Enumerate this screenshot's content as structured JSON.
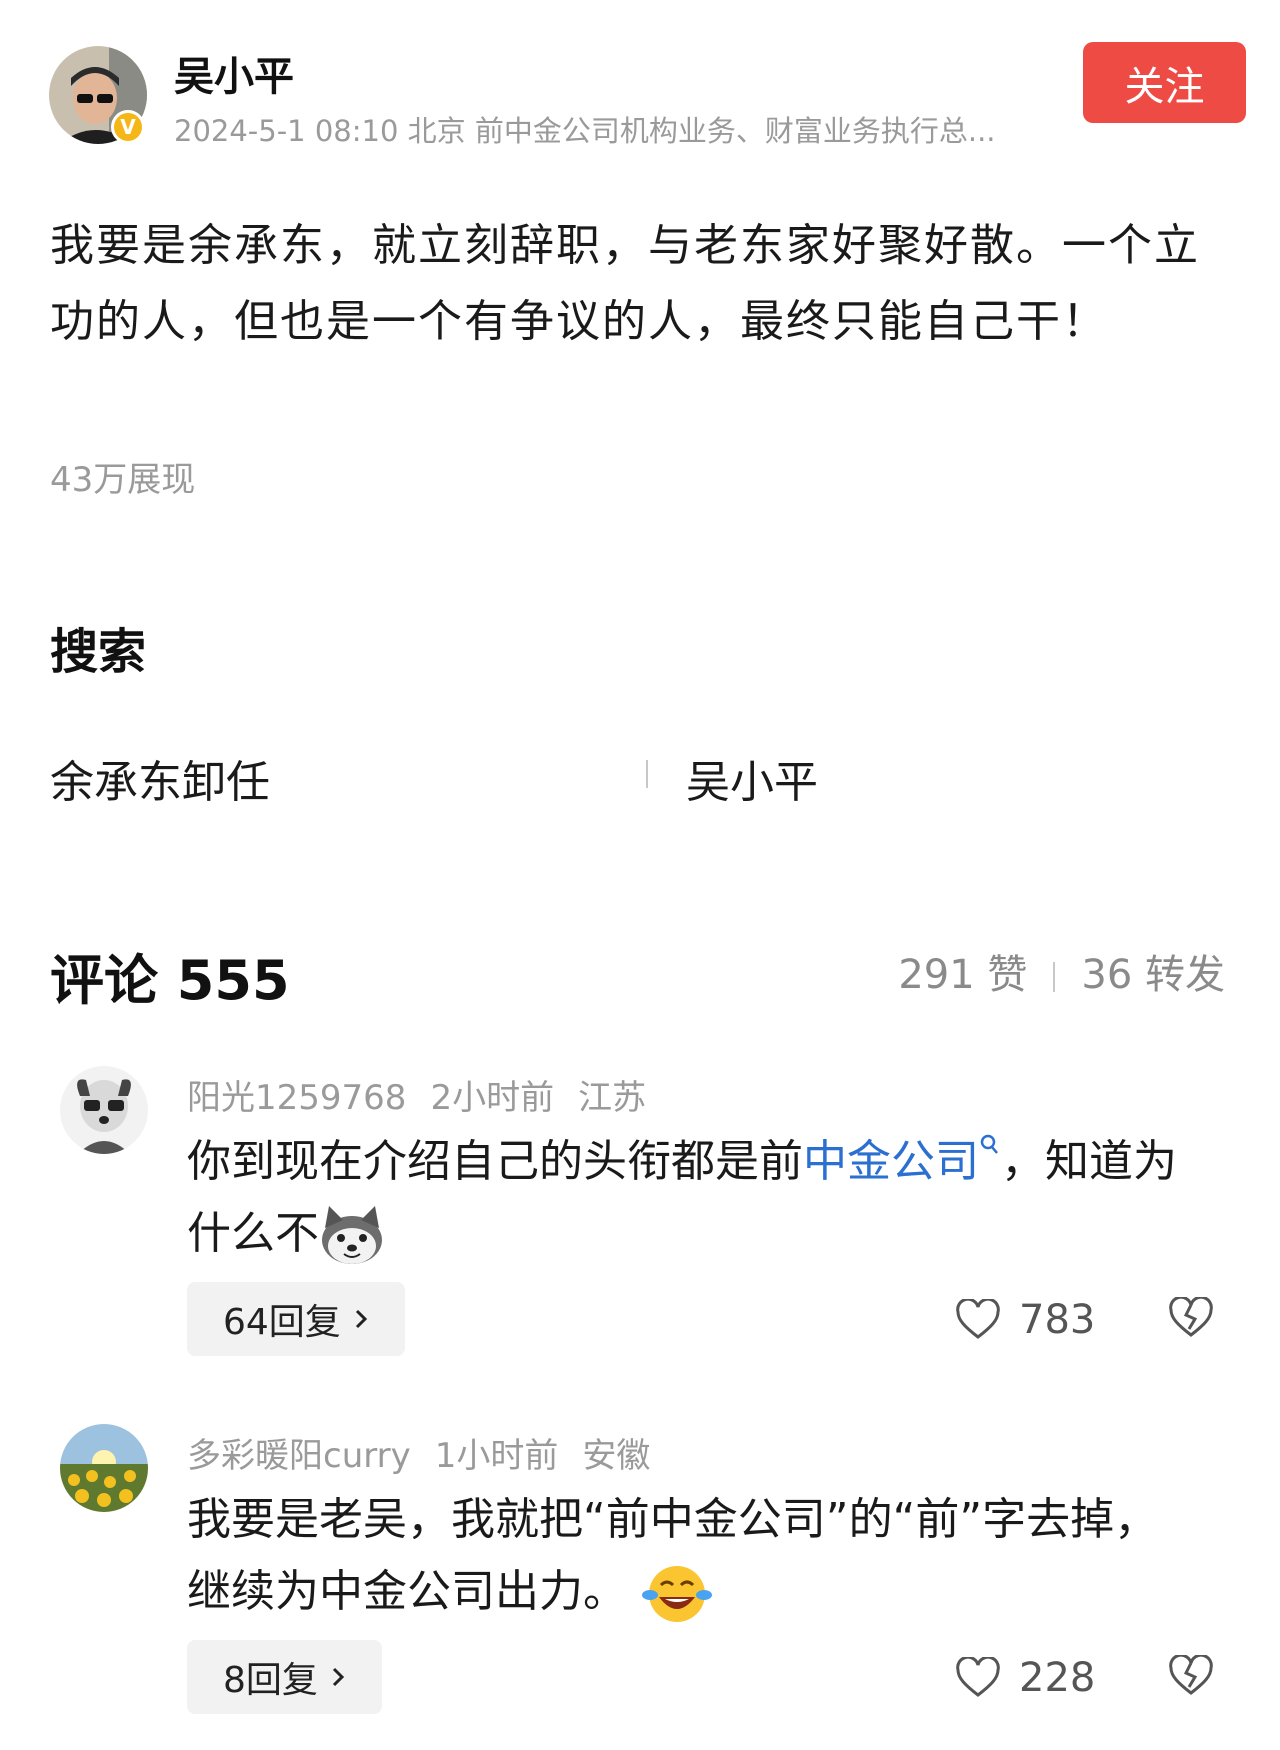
{
  "post": {
    "author": "吴小平",
    "badge": "V",
    "meta": "2024-5-1 08:10 北京 前中金公司机构业务、财富业务执行总...",
    "follow_label": "关注",
    "text": "我要是余承东，就立刻辞职，与老东家好聚好散。一个立功的人，但也是一个有争议的人，最终只能自己干！",
    "views": "43万展现"
  },
  "search": {
    "title": "搜索",
    "items": [
      "余承东卸任",
      "吴小平"
    ]
  },
  "comments_header": {
    "title": "评论 555",
    "likes": "291 赞",
    "reposts": "36 转发"
  },
  "comments": [
    {
      "user": "阳光1259768",
      "time": "2小时前",
      "location": "江苏",
      "text_before": "你到现在介绍自己的头衔都是前",
      "link": "中金公司",
      "text_after": "，知道为什么不",
      "emoji": "husky-emoji",
      "replies": "64回复",
      "likes": "783"
    },
    {
      "user": "多彩暖阳curry",
      "time": "1小时前",
      "location": "安徽",
      "text": "我要是老吴，我就把“前中金公司”的“前”字去掉，继续为中金公司出力。",
      "emoji": "laughing-tears-emoji",
      "replies": "8回复",
      "likes": "228"
    }
  ],
  "colors": {
    "follow": "#ef4b45",
    "link": "#2b6fd1",
    "badge": "#f5b617"
  }
}
